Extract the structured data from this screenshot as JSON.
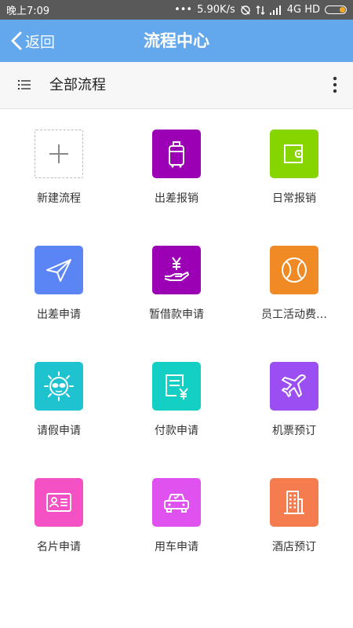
{
  "status_bar": {
    "time": "晚上7:09",
    "network_speed": "5.90K/s",
    "network_type": "4G HD",
    "battery_level": 0.3
  },
  "header": {
    "back_label": "返回",
    "title": "流程中心"
  },
  "filter": {
    "label": "全部流程"
  },
  "colors": {
    "header_bg": "#63a7ec",
    "status_bg": "#595959"
  },
  "items": [
    {
      "label": "新建流程",
      "icon": "plus-icon",
      "color": "#ffffff"
    },
    {
      "label": "出差报销",
      "icon": "luggage-icon",
      "color": "#9b00b4"
    },
    {
      "label": "日常报销",
      "icon": "wallet-icon",
      "color": "#86d400"
    },
    {
      "label": "出差申请",
      "icon": "paper-plane-icon",
      "color": "#5b85f5"
    },
    {
      "label": "暂借款申请",
      "icon": "yen-hand-icon",
      "color": "#9b00b4"
    },
    {
      "label": "员工活动费…",
      "icon": "baseball-icon",
      "color": "#f08a25"
    },
    {
      "label": "请假申请",
      "icon": "sun-glasses-icon",
      "color": "#1ec3cf"
    },
    {
      "label": "付款申请",
      "icon": "invoice-yen-icon",
      "color": "#14cfc4"
    },
    {
      "label": "机票预订",
      "icon": "airplane-icon",
      "color": "#9b4ef2"
    },
    {
      "label": "名片申请",
      "icon": "id-card-icon",
      "color": "#f452c4"
    },
    {
      "label": "用车申请",
      "icon": "car-icon",
      "color": "#df52ef"
    },
    {
      "label": "酒店预订",
      "icon": "hotel-icon",
      "color": "#f47c4f"
    }
  ]
}
